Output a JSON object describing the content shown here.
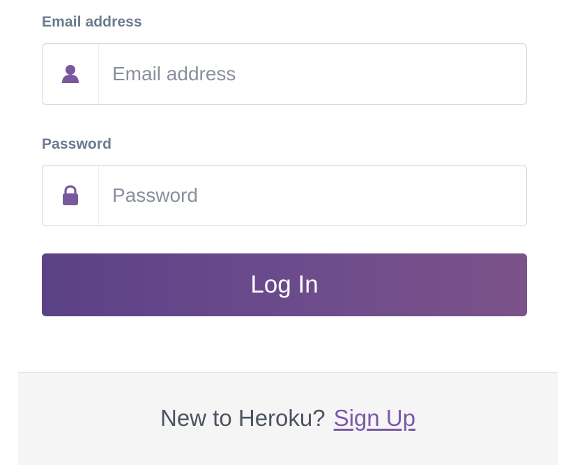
{
  "form": {
    "email": {
      "label": "Email address",
      "placeholder": "Email address",
      "value": "",
      "icon": "user-icon"
    },
    "password": {
      "label": "Password",
      "placeholder": "Password",
      "value": "",
      "icon": "lock-icon"
    },
    "submit_label": "Log In"
  },
  "footer": {
    "prompt": "New to Heroku?",
    "signup_label": "Sign Up"
  },
  "colors": {
    "accent": "#79589f",
    "button_start": "#5b4186",
    "button_end": "#7b5289",
    "label": "#6b7b8f",
    "footer_bg": "#f5f5f6"
  }
}
